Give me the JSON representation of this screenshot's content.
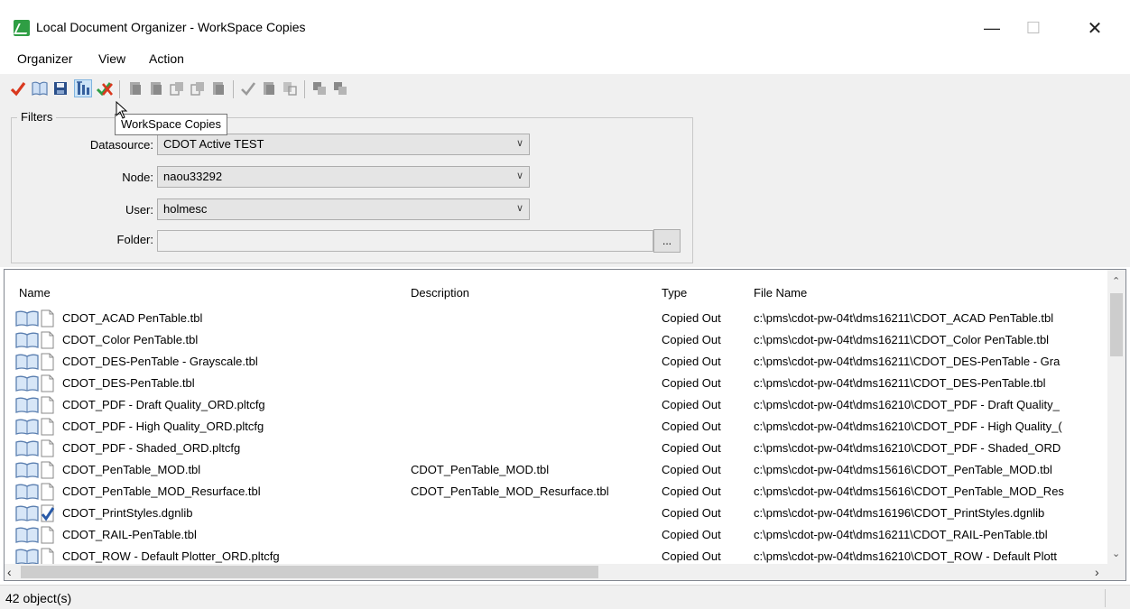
{
  "window": {
    "title": "Local Document Organizer - WorkSpace Copies",
    "minimize": "—",
    "maximize": "☐",
    "close": "✕"
  },
  "menu": [
    {
      "label": "Organizer"
    },
    {
      "label": "View"
    },
    {
      "label": "Action"
    }
  ],
  "toolbar": {
    "tooltip": "WorkSpace Copies",
    "icons": [
      "check-icon",
      "book-icon",
      "save-icon",
      "workspace-copies-icon",
      "check-cancel-icon",
      "doc-icon",
      "doc-icon",
      "doc-copy-icon",
      "doc-copy-icon",
      "doc-icon",
      "check-icon",
      "doc-icon",
      "doc-export-icon",
      "doc-stack-icon",
      "doc-stack-icon"
    ]
  },
  "filters": {
    "legend": "Filters",
    "datasource_label": "Datasource:",
    "datasource_value": "CDOT Active TEST",
    "node_label": "Node:",
    "node_value": "naou33292",
    "user_label": "User:",
    "user_value": "holmesc",
    "folder_label": "Folder:",
    "folder_value": "",
    "browse_label": "..."
  },
  "table": {
    "columns": [
      "Name",
      "Description",
      "Type",
      "File Name"
    ],
    "rows": [
      {
        "name": "CDOT_ACAD PenTable.tbl",
        "description": "",
        "type": "Copied Out",
        "file": "c:\\pms\\cdot-pw-04t\\dms16211\\CDOT_ACAD PenTable.tbl"
      },
      {
        "name": "CDOT_Color PenTable.tbl",
        "description": "",
        "type": "Copied Out",
        "file": "c:\\pms\\cdot-pw-04t\\dms16211\\CDOT_Color PenTable.tbl"
      },
      {
        "name": "CDOT_DES-PenTable - Grayscale.tbl",
        "description": "",
        "type": "Copied Out",
        "file": "c:\\pms\\cdot-pw-04t\\dms16211\\CDOT_DES-PenTable - Gra"
      },
      {
        "name": "CDOT_DES-PenTable.tbl",
        "description": "",
        "type": "Copied Out",
        "file": "c:\\pms\\cdot-pw-04t\\dms16211\\CDOT_DES-PenTable.tbl"
      },
      {
        "name": "CDOT_PDF - Draft Quality_ORD.pltcfg",
        "description": "",
        "type": "Copied Out",
        "file": "c:\\pms\\cdot-pw-04t\\dms16210\\CDOT_PDF - Draft Quality_"
      },
      {
        "name": "CDOT_PDF - High Quality_ORD.pltcfg",
        "description": "",
        "type": "Copied Out",
        "file": "c:\\pms\\cdot-pw-04t\\dms16210\\CDOT_PDF - High Quality_("
      },
      {
        "name": "CDOT_PDF - Shaded_ORD.pltcfg",
        "description": "",
        "type": "Copied Out",
        "file": "c:\\pms\\cdot-pw-04t\\dms16210\\CDOT_PDF - Shaded_ORD"
      },
      {
        "name": "CDOT_PenTable_MOD.tbl",
        "description": "CDOT_PenTable_MOD.tbl",
        "type": "Copied Out",
        "file": "c:\\pms\\cdot-pw-04t\\dms15616\\CDOT_PenTable_MOD.tbl"
      },
      {
        "name": "CDOT_PenTable_MOD_Resurface.tbl",
        "description": "CDOT_PenTable_MOD_Resurface.tbl",
        "type": "Copied Out",
        "file": "c:\\pms\\cdot-pw-04t\\dms15616\\CDOT_PenTable_MOD_Res"
      },
      {
        "name": "CDOT_PrintStyles.dgnlib",
        "description": "",
        "type": "Copied Out",
        "file": "c:\\pms\\cdot-pw-04t\\dms16196\\CDOT_PrintStyles.dgnlib"
      },
      {
        "name": "CDOT_RAIL-PenTable.tbl",
        "description": "",
        "type": "Copied Out",
        "file": "c:\\pms\\cdot-pw-04t\\dms16211\\CDOT_RAIL-PenTable.tbl"
      },
      {
        "name": "CDOT_ROW - Default Plotter_ORD.pltcfg",
        "description": "",
        "type": "Copied Out",
        "file": "c:\\pms\\cdot-pw-04t\\dms16210\\CDOT_ROW - Default Plott"
      }
    ]
  },
  "status": {
    "count": "42 object(s)"
  }
}
